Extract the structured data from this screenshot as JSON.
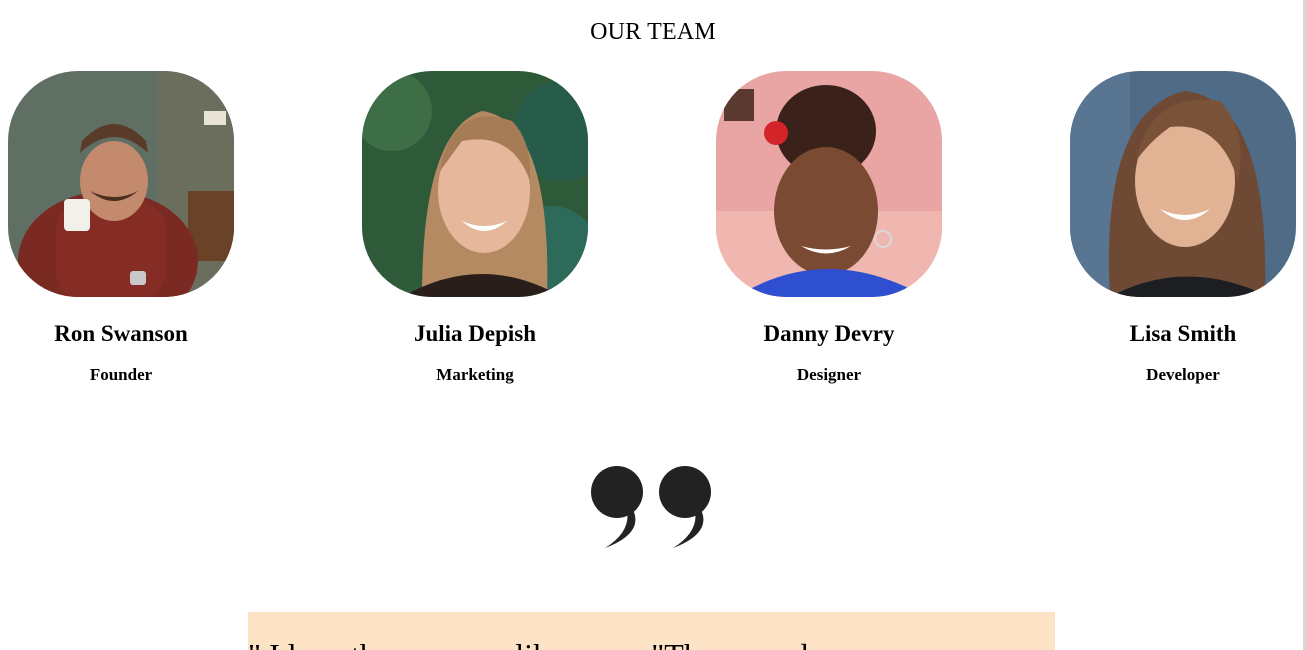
{
  "section": {
    "title": "OUR TEAM"
  },
  "members": [
    {
      "name": "Ron Swanson",
      "role": "Founder",
      "photo_icon": "person-photo"
    },
    {
      "name": "Julia Depish",
      "role": "Marketing",
      "photo_icon": "person-photo"
    },
    {
      "name": "Danny Devry",
      "role": "Designer",
      "photo_icon": "person-photo"
    },
    {
      "name": "Lisa Smith",
      "role": "Developer",
      "photo_icon": "person-photo"
    }
  ],
  "testimonial": {
    "quote_icon": "quote-mark-icon",
    "text": "\" I love the… we … like … … \"The … and …"
  },
  "colors": {
    "quote_box_bg": "#fde3c6",
    "quote_mark": "#222222"
  }
}
